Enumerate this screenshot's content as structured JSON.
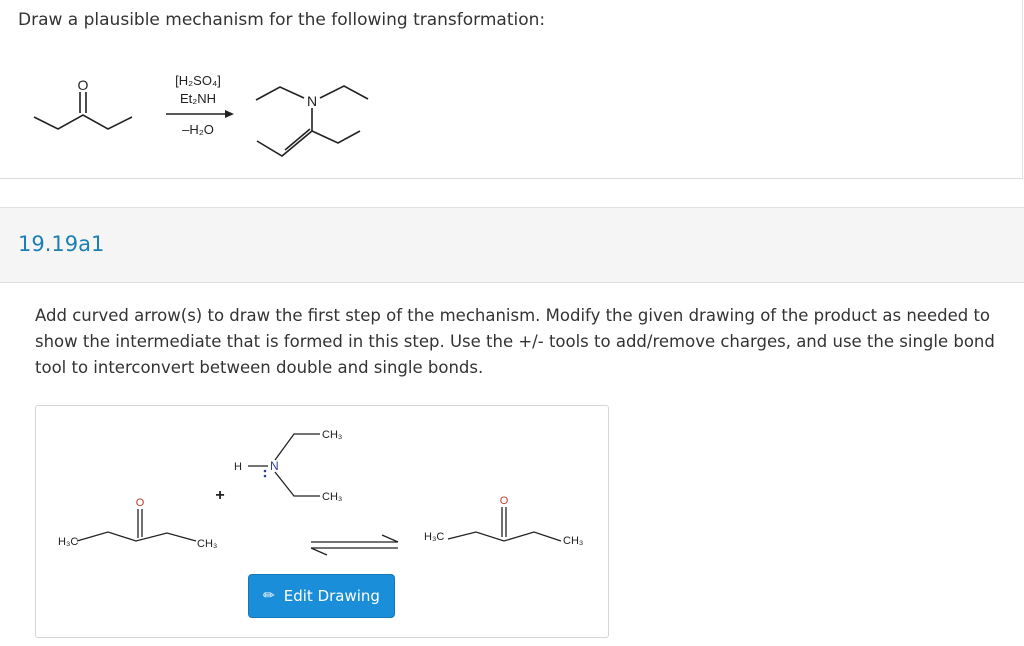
{
  "question": {
    "text": "Draw a plausible mechanism for the following transformation:"
  },
  "reaction": {
    "reagent_acid": "[H₂SO₄]",
    "reagent_amine": "Et₂NH",
    "byproduct": "–H₂O",
    "product_n_label": "N",
    "reactant_o_label": "O"
  },
  "part": {
    "label": "19.19a1"
  },
  "instructions": {
    "text": "Add curved arrow(s) to draw the first step of the mechanism. Modify the given drawing of the product as needed to show the intermediate that is formed in this step. Use the +/- tools to add/remove charges, and use the single bond tool to interconvert between double and single bonds."
  },
  "drawing": {
    "left_h3c": "H₃C",
    "left_ch3": "CH₃",
    "left_o": "O",
    "plus": "+",
    "amine_h": "H",
    "amine_n": "N",
    "amine_ch3_top": "CH₃",
    "amine_ch3_bottom": "CH₃",
    "right_h3c": "H₃C",
    "right_ch3": "CH₃",
    "right_o": "O",
    "edit_button": "Edit Drawing",
    "edit_icon": "pencil-icon"
  }
}
